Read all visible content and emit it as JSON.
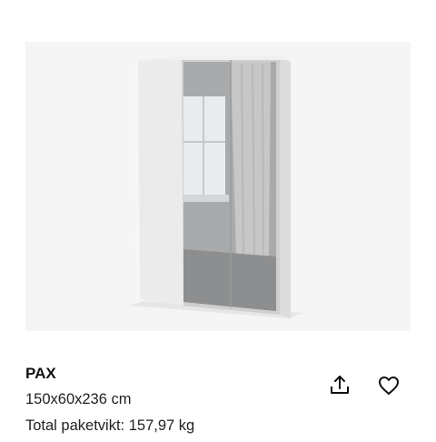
{
  "product": {
    "name": "PAX",
    "dimensions": "150x60x236 cm",
    "package_weight": "Total paketvikt: 157,97 kg",
    "image_icon": "wardrobe-image"
  },
  "actions": {
    "share_icon": "share-icon",
    "favorite_icon": "heart-icon"
  },
  "colors": {
    "image_background": "#f5f5f5",
    "text": "#111111"
  }
}
